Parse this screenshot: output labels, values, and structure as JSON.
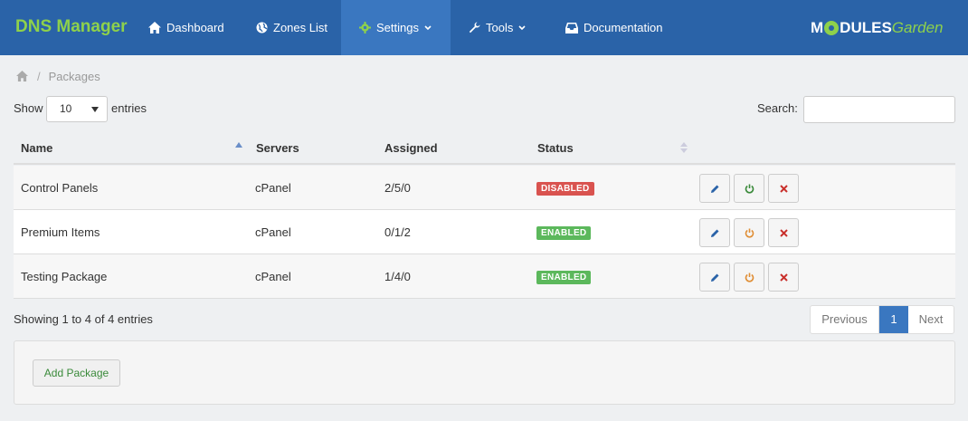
{
  "navbar": {
    "brand": "DNS Manager",
    "items": [
      {
        "label": "Dashboard",
        "icon": "home-icon"
      },
      {
        "label": "Zones List",
        "icon": "globe-icon"
      },
      {
        "label": "Settings",
        "icon": "gear-icon",
        "active": true
      },
      {
        "label": "Tools",
        "icon": "wrench-icon"
      },
      {
        "label": "Documentation",
        "icon": "inbox-icon"
      }
    ],
    "logo": {
      "part1": "M",
      "part2": "DULES",
      "part3": "Garden"
    }
  },
  "breadcrumb": {
    "current": "Packages"
  },
  "controls": {
    "show_label": "Show",
    "entries_value": "10",
    "entries_label": "entries",
    "search_label": "Search:",
    "search_value": ""
  },
  "table": {
    "headers": [
      "Name",
      "Servers",
      "Assigned",
      "Status"
    ],
    "rows": [
      {
        "name": "Control Panels",
        "servers": "cPanel",
        "assigned": "2/5/0",
        "status": "DISABLED"
      },
      {
        "name": "Premium Items",
        "servers": "cPanel",
        "assigned": "0/1/2",
        "status": "ENABLED"
      },
      {
        "name": "Testing Package",
        "servers": "cPanel",
        "assigned": "1/4/0",
        "status": "ENABLED"
      }
    ]
  },
  "footer": {
    "info": "Showing 1 to 4 of 4 entries",
    "pagination": {
      "previous": "Previous",
      "current": "1",
      "next": "Next"
    },
    "add_button": "Add Package"
  },
  "colors": {
    "navbar": "#2a63a8",
    "brand": "#8ed14b",
    "disabled": "#d9534f",
    "enabled": "#5cb85c",
    "edit_icon": "#2a63a8",
    "power_on_icon": "#3a8a3a",
    "power_off_icon": "#e08e35",
    "delete_icon": "#c9302c"
  }
}
